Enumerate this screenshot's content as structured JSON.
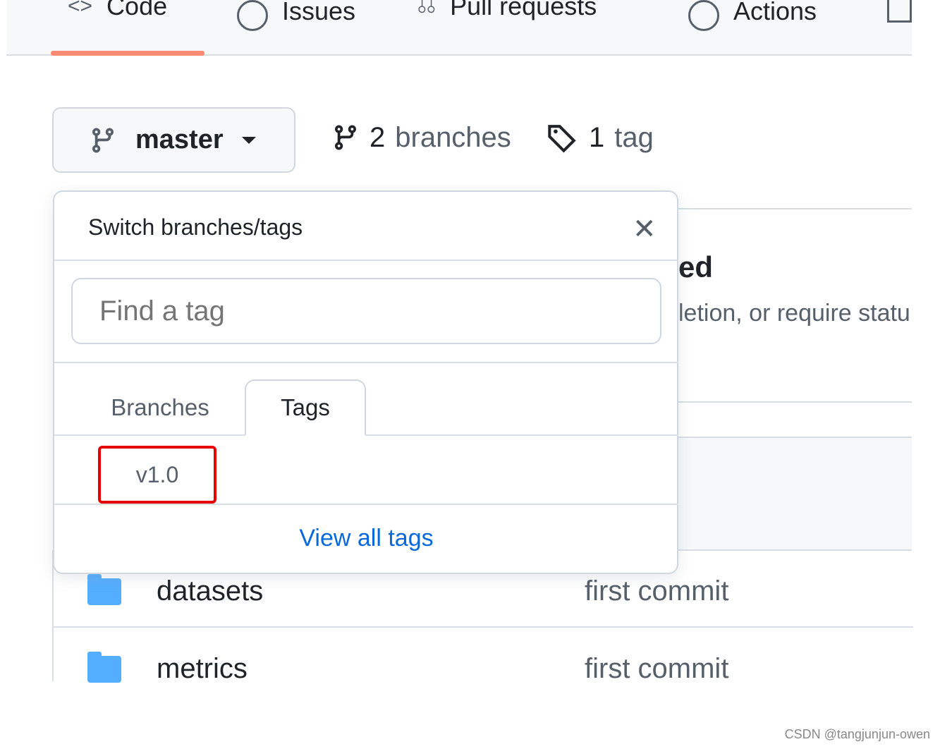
{
  "nav": {
    "tabs": [
      {
        "label": "Code",
        "icon": "code-icon",
        "active": true
      },
      {
        "label": "Issues",
        "icon": "issue-icon"
      },
      {
        "label": "Pull requests",
        "icon": "pull-request-icon"
      },
      {
        "label": "Actions",
        "icon": "play-icon"
      }
    ],
    "accent": "#fd8c73"
  },
  "branch": {
    "current": "master",
    "branches_count": "2",
    "branches_label": "branches",
    "tags_count": "1",
    "tags_label": "tag"
  },
  "background": {
    "heading_fragment": "ed",
    "text_fragment": "letion, or require statu"
  },
  "dropdown": {
    "title": "Switch branches/tags",
    "search_placeholder": "Find a tag",
    "tabs": [
      "Branches",
      "Tags"
    ],
    "active_tab": "Tags",
    "items": [
      "v1.0"
    ],
    "view_all": "View all tags",
    "highlight_color": "#e60000"
  },
  "files": [
    {
      "name": "datasets",
      "message": "first commit"
    },
    {
      "name": "metrics",
      "message": "first commit"
    }
  ],
  "watermark": "CSDN @tangjunjun-owen"
}
